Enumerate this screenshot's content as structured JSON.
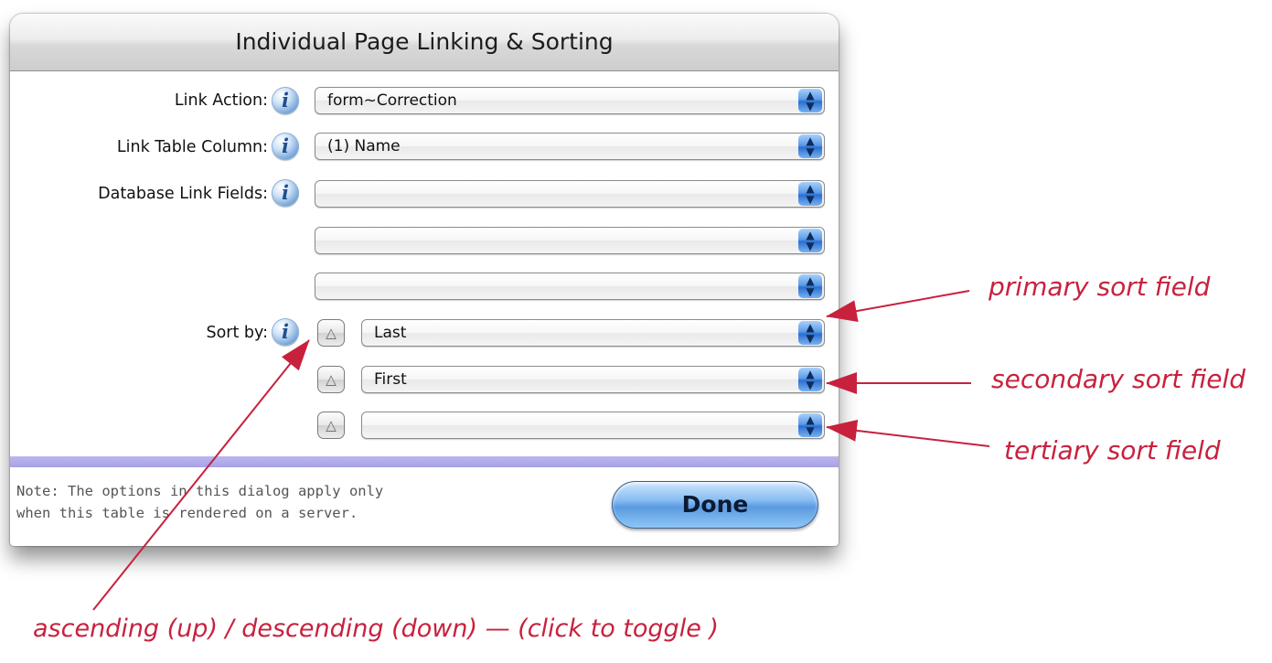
{
  "dialog": {
    "title": "Individual Page Linking & Sorting",
    "rows": {
      "link_action": {
        "label": "Link Action:",
        "value": "form~Correction"
      },
      "link_table_column": {
        "label": "Link Table Column:",
        "value": "(1) Name"
      },
      "database_link_fields": {
        "label": "Database Link Fields:",
        "values": [
          "",
          "",
          ""
        ]
      },
      "sort_by": {
        "label": "Sort by:",
        "values": [
          "Last",
          "First",
          ""
        ],
        "direction_icon": "up-triangle-icon"
      }
    },
    "info_icon_glyph": "i",
    "popup_arrow_glyph": "▲\n▼",
    "sort_toggle_glyph": "△",
    "note_lines": [
      "Note: The options in this dialog apply only",
      "when this table is rendered on a server."
    ],
    "done_label": "Done"
  },
  "annotations": {
    "primary": "primary sort field",
    "secondary": "secondary sort field",
    "tertiary": "tertiary sort field",
    "toggle": "ascending (up) / descending (down) — (click to toggle )",
    "color": "#c8213e"
  }
}
